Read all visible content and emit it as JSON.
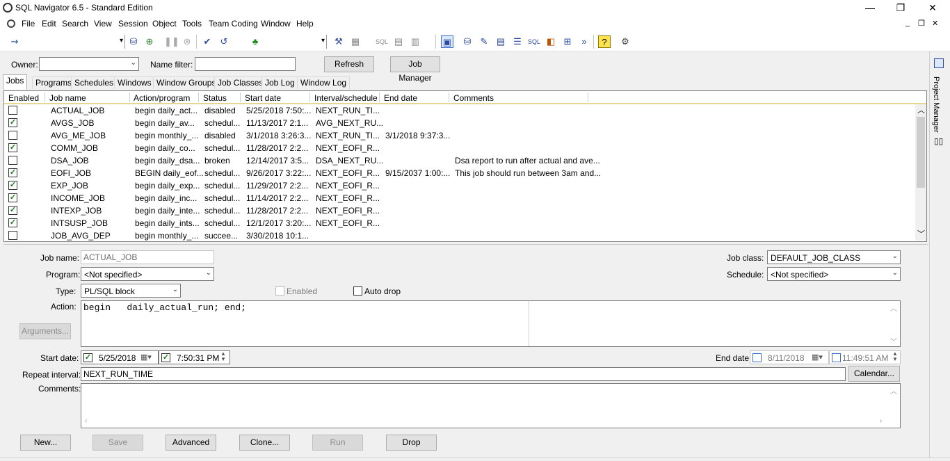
{
  "window": {
    "title": "SQL Navigator 6.5 - Standard Edition",
    "controls": [
      "—",
      "❐",
      "✕"
    ]
  },
  "menu": {
    "items": [
      "File",
      "Edit",
      "Search",
      "View",
      "Session",
      "Object",
      "Tools",
      "Team Coding",
      "Window",
      "Help"
    ],
    "mdi_controls": [
      "_",
      "❐",
      "✕"
    ]
  },
  "filter": {
    "owner_label": "Owner:",
    "owner_value": "",
    "name_filter_label": "Name filter:",
    "name_filter_value": "",
    "refresh_label": "Refresh",
    "job_manager_label": "Job Manager"
  },
  "tabs": [
    "Jobs",
    "Programs",
    "Schedules",
    "Windows",
    "Window Groups",
    "Job Classes",
    "Job Log",
    "Window Log"
  ],
  "grid": {
    "columns": [
      "Enabled",
      "Job name",
      "Action/program",
      "Status",
      "Start date",
      "Interval/schedule",
      "End date",
      "Comments"
    ],
    "rows": [
      {
        "enabled": false,
        "name": "ACTUAL_JOB",
        "action": "begin  daily_act...",
        "status": "disabled",
        "start": "5/25/2018 7:50:...",
        "interval": "NEXT_RUN_TI...",
        "end": "",
        "comments": ""
      },
      {
        "enabled": true,
        "name": "AVGS_JOB",
        "action": "begin  daily_av...",
        "status": "schedul...",
        "start": "11/13/2017 2:1...",
        "interval": "AVG_NEXT_RU...",
        "end": "",
        "comments": ""
      },
      {
        "enabled": false,
        "name": "AVG_ME_JOB",
        "action": "begin  monthly_...",
        "status": "disabled",
        "start": "3/1/2018 3:26:3...",
        "interval": "NEXT_RUN_TI...",
        "end": "3/1/2018 9:37:3...",
        "comments": ""
      },
      {
        "enabled": true,
        "name": "COMM_JOB",
        "action": "begin  daily_co...",
        "status": "schedul...",
        "start": "11/28/2017 2:2...",
        "interval": "NEXT_EOFI_R...",
        "end": "",
        "comments": ""
      },
      {
        "enabled": false,
        "name": "DSA_JOB",
        "action": "begin  daily_dsa...",
        "status": "broken",
        "start": "12/14/2017 3:5...",
        "interval": "DSA_NEXT_RU...",
        "end": "",
        "comments": "Dsa report to run after actual and ave..."
      },
      {
        "enabled": true,
        "name": "EOFI_JOB",
        "action": "BEGIN daily_eof...",
        "status": "schedul...",
        "start": "9/26/2017 3:22:...",
        "interval": "NEXT_EOFI_R...",
        "end": "9/15/2037 1:00:...",
        "comments": "This job should run between 3am and..."
      },
      {
        "enabled": true,
        "name": "EXP_JOB",
        "action": "begin  daily_exp...",
        "status": "schedul...",
        "start": "11/29/2017 2:2...",
        "interval": "NEXT_EOFI_R...",
        "end": "",
        "comments": ""
      },
      {
        "enabled": true,
        "name": "INCOME_JOB",
        "action": "begin  daily_inc...",
        "status": "schedul...",
        "start": "11/14/2017 2:2...",
        "interval": "NEXT_EOFI_R...",
        "end": "",
        "comments": ""
      },
      {
        "enabled": true,
        "name": "INTEXP_JOB",
        "action": "begin  daily_inte...",
        "status": "schedul...",
        "start": "11/28/2017 2:2...",
        "interval": "NEXT_EOFI_R...",
        "end": "",
        "comments": ""
      },
      {
        "enabled": true,
        "name": "INTSUSP_JOB",
        "action": "begin  daily_ints...",
        "status": "schedul...",
        "start": "12/1/2017 3:20:...",
        "interval": "NEXT_EOFI_R...",
        "end": "",
        "comments": ""
      },
      {
        "enabled": false,
        "name": "JOB_AVG_DEP",
        "action": "begin  monthly_...",
        "status": "succee...",
        "start": "3/30/2018 10:1...",
        "interval": "",
        "end": "",
        "comments": ""
      }
    ]
  },
  "detail": {
    "job_name_label": "Job name:",
    "job_name_value": "ACTUAL_JOB",
    "program_label": "Program:",
    "program_value": "<Not specified>",
    "type_label": "Type:",
    "type_value": "PL/SQL block",
    "enabled_label": "Enabled",
    "auto_drop_label": "Auto drop",
    "action_label": "Action:",
    "action_value": "begin   daily_actual_run; end;",
    "arguments_label": "Arguments...",
    "job_class_label": "Job class:",
    "job_class_value": "DEFAULT_JOB_CLASS",
    "schedule_label": "Schedule:",
    "schedule_value": "<Not specified>",
    "start_date_label": "Start date:",
    "start_date_value": "5/25/2018",
    "start_time_value": "7:50:31 PM",
    "end_date_label": "End date:",
    "end_date_value": "8/11/2018",
    "end_time_value": "11:49:51 AM",
    "repeat_label": "Repeat interval:",
    "repeat_value": "NEXT_RUN_TIME",
    "calendar_label": "Calendar...",
    "comments_label": "Comments:",
    "comments_value": ""
  },
  "buttons": {
    "new": "New...",
    "save": "Save",
    "advanced": "Advanced",
    "clone": "Clone...",
    "run": "Run",
    "drop": "Drop"
  },
  "right_panel": {
    "project_manager_label": "Project Manager"
  }
}
